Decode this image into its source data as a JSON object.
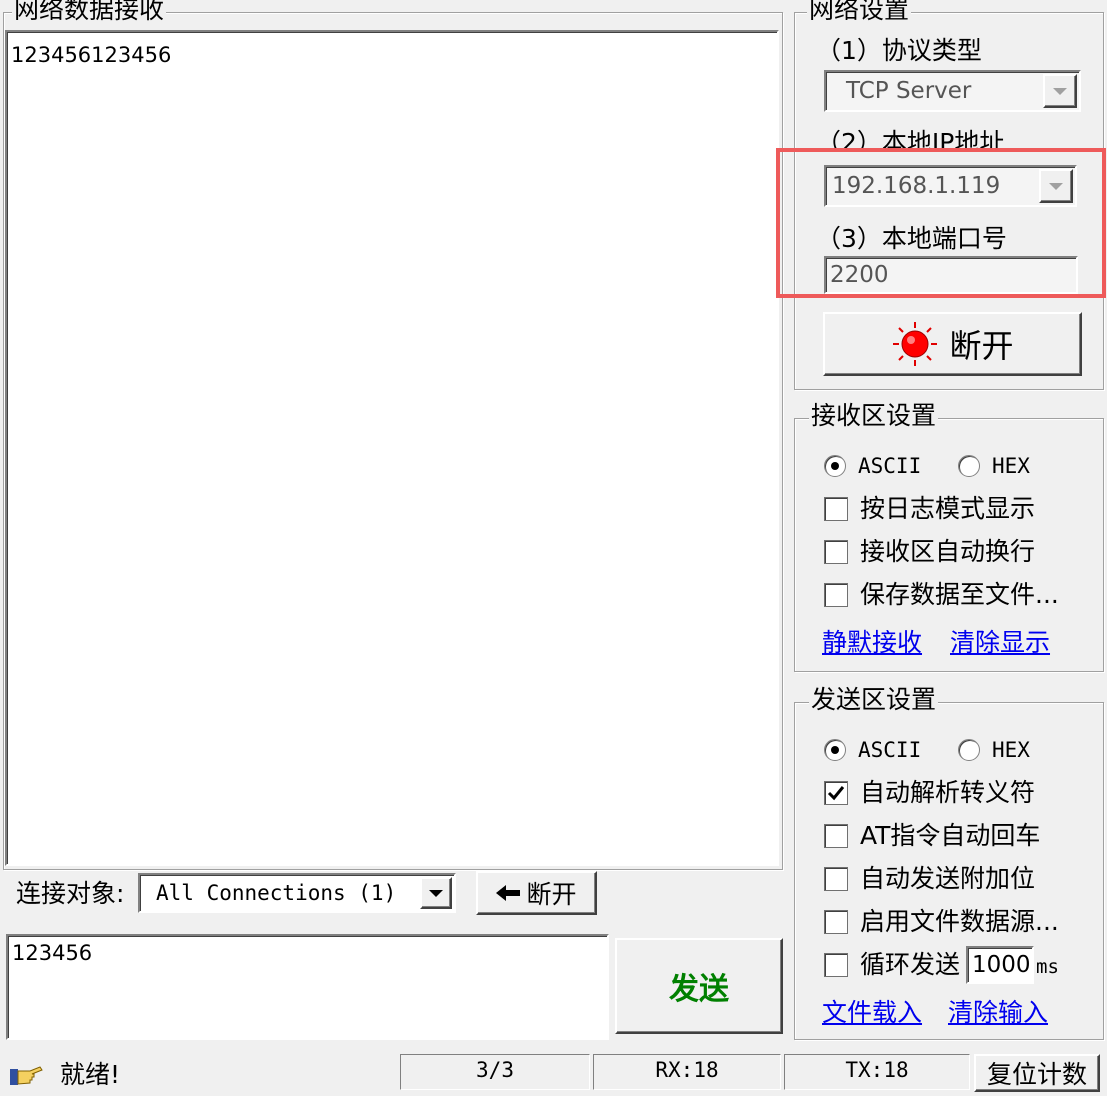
{
  "receive_panel": {
    "title": "网络数据接收",
    "content": "123456123456"
  },
  "network_settings": {
    "title": "网络设置",
    "protocol_label": "（1）协议类型",
    "protocol_value": "TCP Server",
    "ip_label": "（2）本地IP地址",
    "ip_value": "192.168.1.119",
    "port_label": "（3）本地端口号",
    "port_value": "2200",
    "connect_button": "断开",
    "highlight_color": "#ee5a5a"
  },
  "receive_settings": {
    "title": "接收区设置",
    "radio_ascii": "ASCII",
    "radio_hex": "HEX",
    "selected": "ASCII",
    "options": [
      {
        "label": "按日志模式显示",
        "checked": false
      },
      {
        "label": "接收区自动换行",
        "checked": false
      },
      {
        "label": "保存数据至文件...",
        "checked": false
      }
    ],
    "link_pause": "静默接收",
    "link_clear": "清除显示"
  },
  "send_settings": {
    "title": "发送区设置",
    "radio_ascii": "ASCII",
    "radio_hex": "HEX",
    "selected": "ASCII",
    "options": [
      {
        "label": "自动解析转义符",
        "checked": true
      },
      {
        "label": "AT指令自动回车",
        "checked": false
      },
      {
        "label": "自动发送附加位",
        "checked": false
      },
      {
        "label": "启用文件数据源...",
        "checked": false
      },
      {
        "label": "循环发送",
        "checked": false
      }
    ],
    "loop_interval": "1000",
    "loop_unit": "ms",
    "link_load": "文件载入",
    "link_clear": "清除输入"
  },
  "connection_bar": {
    "label": "连接对象:",
    "selected": "All Connections (1)",
    "disconnect_button": "断开"
  },
  "send_area": {
    "content": "123456",
    "send_button": "发送"
  },
  "status_bar": {
    "status_text": "就绪!",
    "count": "3/3",
    "rx": "RX:18",
    "tx": "TX:18",
    "reset_button": "复位计数"
  }
}
